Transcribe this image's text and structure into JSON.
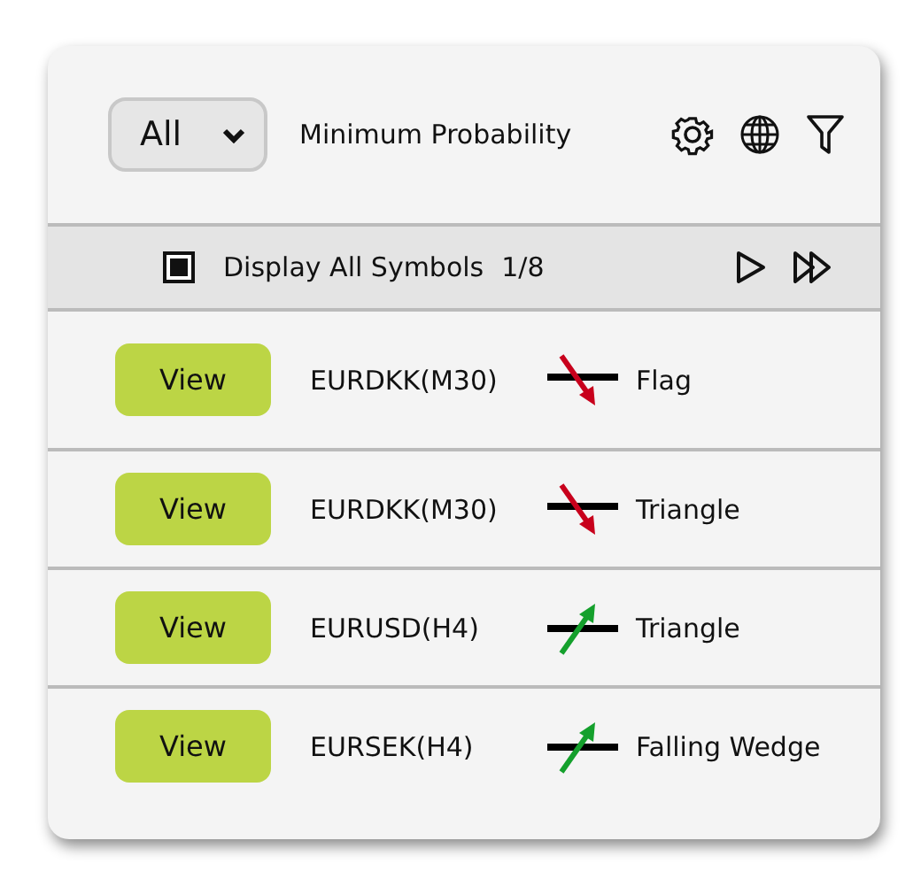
{
  "filter": {
    "value": "All"
  },
  "label": "Minimum Probability",
  "display_all": {
    "label": "Display All Symbols",
    "checked": true,
    "count": "1/8"
  },
  "rows": [
    {
      "button": "View",
      "symbol": "EURDKK(M30)",
      "kind": "down",
      "pattern": "Flag"
    },
    {
      "button": "View",
      "symbol": "EURDKK(M30)",
      "kind": "down",
      "pattern": "Triangle"
    },
    {
      "button": "View",
      "symbol": "EURUSD(H4)",
      "kind": "up",
      "pattern": "Triangle"
    },
    {
      "button": "View",
      "symbol": "EURSEK(H4)",
      "kind": "up",
      "pattern": "Falling Wedge"
    }
  ]
}
